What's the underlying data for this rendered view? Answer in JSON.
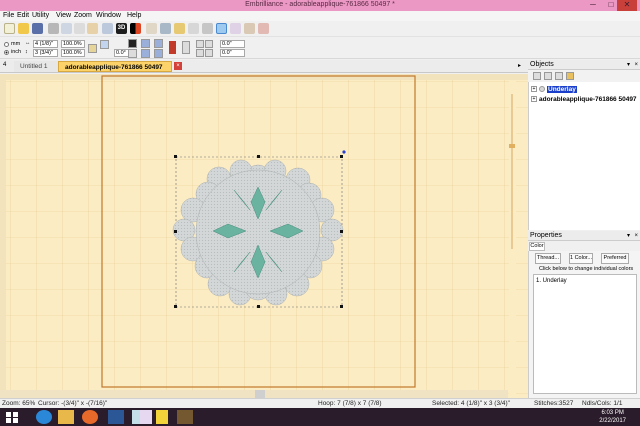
{
  "window": {
    "title": "Embrilliance - adorableapplique-761866 50497 *",
    "min_glyph": "─",
    "max_glyph": "□",
    "close_glyph": "✕"
  },
  "menu": [
    "File",
    "Edit",
    "Utility",
    "View",
    "Zoom",
    "Window",
    "Help"
  ],
  "toolbar2": {
    "unit_mm": "mm",
    "unit_inch": "inch",
    "width_symbol": "↔",
    "height_symbol": "↕",
    "width_value": "4 (1/8)\"",
    "height_value": "3 (3/4)\"",
    "scale_x": "100.0%",
    "scale_y": "100.0%",
    "rotation": "0.0°",
    "pos_x": "0.0\"",
    "pos_y": "0.0\""
  },
  "tabs": {
    "untitled": "Untitled 1",
    "active": "adorableapplique-761866 50497 *",
    "close": "×",
    "nav_left": "4",
    "nav_right": "▸"
  },
  "objects_panel": {
    "title": "Objects",
    "items": [
      {
        "label": "Underlay",
        "selected": true
      },
      {
        "label": "adorableapplique-761866 50497",
        "selected": false
      }
    ]
  },
  "properties_panel": {
    "title": "Properties",
    "tab": "Color",
    "buttons": [
      "Thread...",
      "1 Color...",
      "Preferred"
    ],
    "hint": "Click below to change individual colors",
    "list_item": "1. Underlay"
  },
  "panel_pin": "▾",
  "panel_close": "×",
  "status": {
    "zoom": "Zoom: 65%",
    "cursor": "Cursor: -(3/4)\" x -(7/16)\"",
    "hoop": "Hoop: 7 (7/8) x 7 (7/8)",
    "selected": "Selected: 4 (1/8)\" x 3 (3/4)\"",
    "stitches": "Stitches:3527",
    "ndls": "Ndls/Cols: 1/1"
  },
  "clock": {
    "time": "6:03 PM",
    "date": "2/22/2017"
  },
  "colors": {
    "titlebar": "#eb98c4",
    "canvas_bg": "#fcecc4",
    "hoop_line": "#c07828",
    "design_fill": "#d0d3d3",
    "petal": "#6ab3a1",
    "taskbar": "#2a1c2a",
    "selection": "#1a3fcc"
  },
  "icons": {
    "toolbar": [
      "new-icon",
      "open-icon",
      "save-icon",
      "print-icon",
      "cut-icon",
      "copy-icon",
      "paste-icon",
      "undo-icon",
      "redo-icon",
      "pointer-icon",
      "hoop-icon",
      "3d-icon",
      "thread-icon",
      "zoom-icon",
      "select-icon",
      "measure-icon",
      "grid-icon",
      "pan-icon",
      "lasso-icon",
      "text-icon",
      "sew-icon"
    ],
    "taskbar": [
      "windows-start-icon",
      "ie-icon",
      "folder-icon",
      "firefox-icon",
      "word-icon",
      "media-icon",
      "app-icon",
      "sticky-icon",
      "embrilliance-icon"
    ]
  }
}
